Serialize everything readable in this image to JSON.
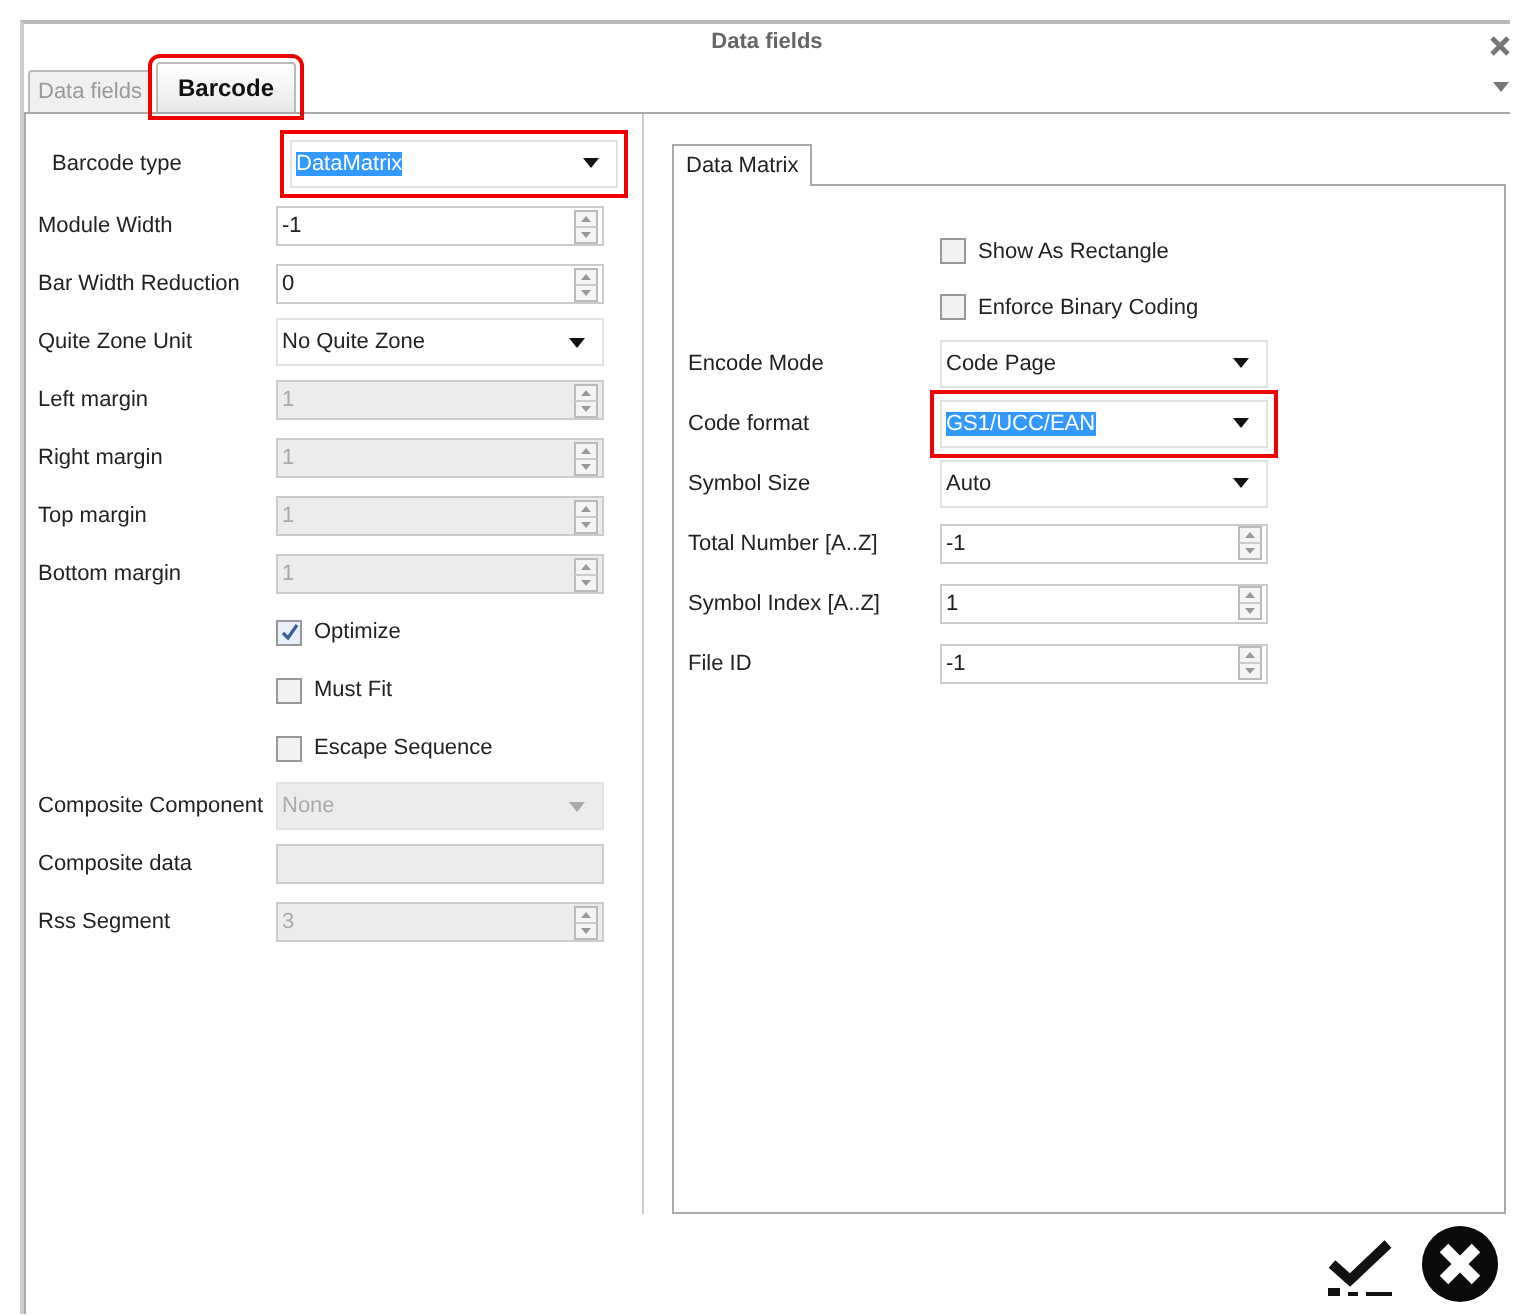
{
  "window": {
    "title": "Data fields"
  },
  "tabs": [
    {
      "label": "Data fields",
      "selected": false,
      "highlighted": false
    },
    {
      "label": "Barcode",
      "selected": true,
      "highlighted": true
    }
  ],
  "left_rows": [
    {
      "kind": "dropdown",
      "label": "Barcode type",
      "value": "DataMatrix",
      "disabled": false,
      "highlighted": true,
      "text_selected": true
    },
    {
      "kind": "spinner",
      "label": "Module Width",
      "value": "-1",
      "disabled": false
    },
    {
      "kind": "spinner",
      "label": "Bar Width Reduction",
      "value": "0",
      "disabled": false
    },
    {
      "kind": "dropdown",
      "label": "Quite Zone Unit",
      "value": "No Quite Zone",
      "disabled": false,
      "highlighted": false,
      "text_selected": false
    },
    {
      "kind": "spinner",
      "label": "Left margin",
      "value": "1",
      "disabled": true
    },
    {
      "kind": "spinner",
      "label": "Right margin",
      "value": "1",
      "disabled": true
    },
    {
      "kind": "spinner",
      "label": "Top margin",
      "value": "1",
      "disabled": true
    },
    {
      "kind": "spinner",
      "label": "Bottom margin",
      "value": "1",
      "disabled": true
    },
    {
      "kind": "checkbox",
      "label": "Optimize",
      "checked": true
    },
    {
      "kind": "checkbox",
      "label": "Must Fit",
      "checked": false
    },
    {
      "kind": "checkbox",
      "label": "Escape Sequence",
      "checked": false
    },
    {
      "kind": "dropdown",
      "label": "Composite Component",
      "value": "None",
      "disabled": true,
      "highlighted": false,
      "text_selected": false
    },
    {
      "kind": "text",
      "label": "Composite data",
      "disabled": true
    },
    {
      "kind": "spinner",
      "label": "Rss Segment",
      "value": "3",
      "disabled": true
    }
  ],
  "sub_tab": {
    "label": "Data Matrix"
  },
  "right_rows": [
    {
      "kind": "checkbox",
      "label": "Show As Rectangle",
      "checked": false
    },
    {
      "kind": "checkbox",
      "label": "Enforce Binary Coding",
      "checked": false
    },
    {
      "kind": "dropdown",
      "label": "Encode Mode",
      "value": "Code Page",
      "disabled": false,
      "highlighted": false,
      "text_selected": false
    },
    {
      "kind": "dropdown",
      "label": "Code format",
      "value": "GS1/UCC/EAN",
      "disabled": false,
      "highlighted": true,
      "text_selected": true
    },
    {
      "kind": "dropdown",
      "label": "Symbol Size",
      "value": "Auto",
      "disabled": false,
      "highlighted": false,
      "text_selected": false
    },
    {
      "kind": "spinner",
      "label": "Total Number [A..Z]",
      "value": "-1",
      "disabled": false
    },
    {
      "kind": "spinner",
      "label": "Symbol Index [A..Z]",
      "value": "1",
      "disabled": false
    },
    {
      "kind": "spinner",
      "label": "File ID",
      "value": "-1",
      "disabled": false
    }
  ]
}
